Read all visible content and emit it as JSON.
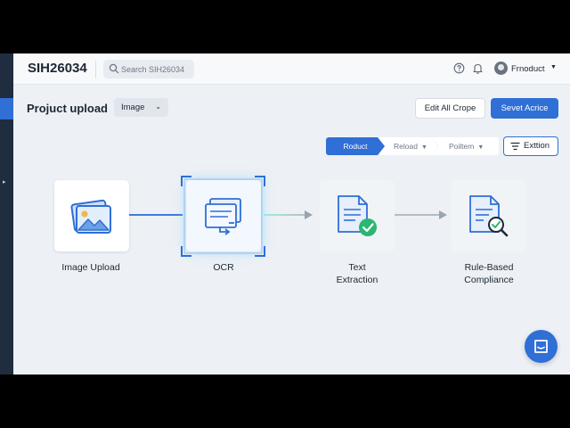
{
  "app": {
    "title": "SIH26034"
  },
  "search": {
    "placeholder": "Search SIH26034"
  },
  "user": {
    "name": "Frnoduct"
  },
  "page": {
    "title": "Projuct upload",
    "type_value": "Image"
  },
  "actions": {
    "edit_label": "Edit All Crope",
    "primary_label": "Sevet Acrice"
  },
  "steps": [
    {
      "label": "Roduct",
      "active": true
    },
    {
      "label": "Reload",
      "active": false
    },
    {
      "label": "Poiltem",
      "active": false
    }
  ],
  "filter": {
    "label": "Exttion"
  },
  "flow": [
    {
      "label": "Image Upload",
      "icon": "image-icon"
    },
    {
      "label": "OCR",
      "icon": "ocr-scan-icon",
      "selected": true
    },
    {
      "label": "Text\nExtraction",
      "icon": "document-check-icon"
    },
    {
      "label": "Rule-Based\nCompliance",
      "icon": "document-search-icon"
    }
  ],
  "icons": {
    "search": "search-icon",
    "help": "help-icon",
    "notifications": "bell-icon",
    "chat": "chat-icon",
    "filter": "filter-icon"
  },
  "colors": {
    "accent": "#2f6fd6",
    "rail": "#1f2d3f",
    "background": "#edf1f5",
    "success": "#2bb673"
  }
}
